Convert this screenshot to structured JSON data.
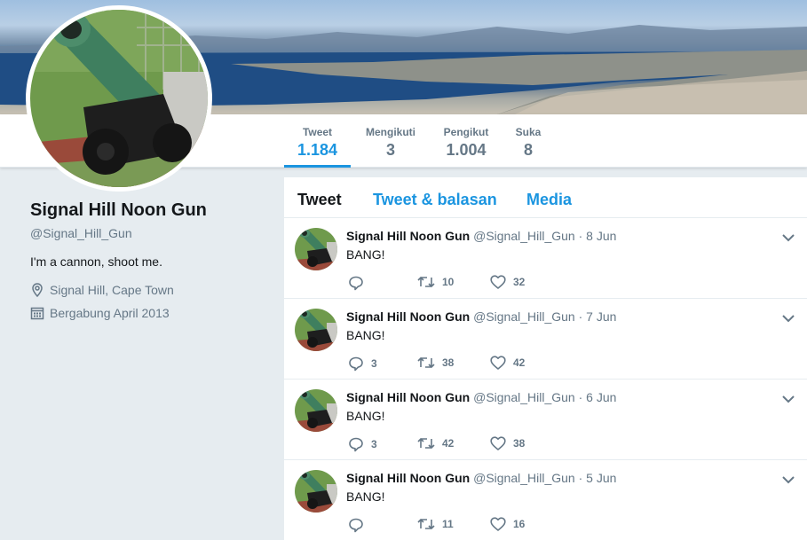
{
  "stats": [
    {
      "label": "Tweet",
      "value": "1.184"
    },
    {
      "label": "Mengikuti",
      "value": "3"
    },
    {
      "label": "Pengikut",
      "value": "1.004"
    },
    {
      "label": "Suka",
      "value": "8"
    }
  ],
  "profile": {
    "name": "Signal Hill Noon Gun",
    "handle": "@Signal_Hill_Gun",
    "bio": "I'm a cannon, shoot me.",
    "location": "Signal Hill, Cape Town",
    "joined": "Bergabung April 2013"
  },
  "tabs": [
    "Tweet",
    "Tweet & balasan",
    "Media"
  ],
  "tweets": [
    {
      "name": "Signal Hill Noon Gun",
      "handle": "@Signal_Hill_Gun",
      "sep": "·",
      "date": "8 Jun",
      "text": "BANG!",
      "replies": "",
      "retweets": "10",
      "likes": "32"
    },
    {
      "name": "Signal Hill Noon Gun",
      "handle": "@Signal_Hill_Gun",
      "sep": "·",
      "date": "7 Jun",
      "text": "BANG!",
      "replies": "3",
      "retweets": "38",
      "likes": "42"
    },
    {
      "name": "Signal Hill Noon Gun",
      "handle": "@Signal_Hill_Gun",
      "sep": "·",
      "date": "6 Jun",
      "text": "BANG!",
      "replies": "3",
      "retweets": "42",
      "likes": "38"
    },
    {
      "name": "Signal Hill Noon Gun",
      "handle": "@Signal_Hill_Gun",
      "sep": "·",
      "date": "5 Jun",
      "text": "BANG!",
      "replies": "",
      "retweets": "11",
      "likes": "16"
    }
  ],
  "icons": {
    "location": "location-pin-icon",
    "calendar": "calendar-icon",
    "reply": "reply-icon",
    "retweet": "retweet-icon",
    "like": "heart-icon",
    "more": "chevron-down-icon"
  },
  "colors": {
    "accent": "#1b95e0",
    "muted": "#657786",
    "background": "#e6ecf0"
  }
}
